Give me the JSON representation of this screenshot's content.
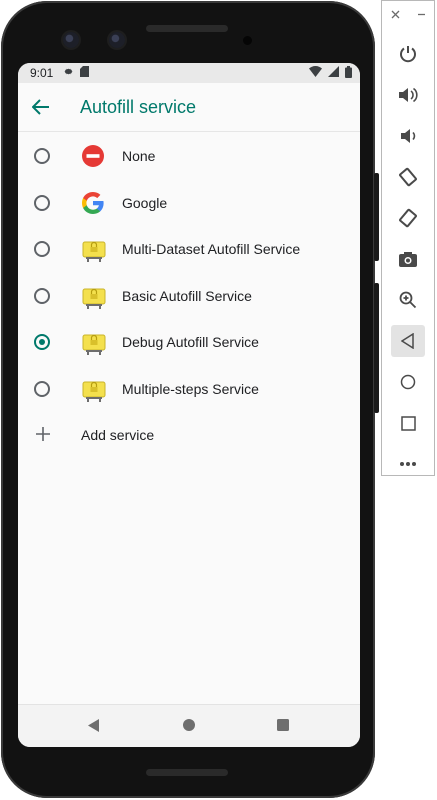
{
  "status_bar": {
    "time": "9:01"
  },
  "app_bar": {
    "title": "Autofill service"
  },
  "services": [
    {
      "label": "None",
      "icon": "none-circle-icon",
      "selected": false
    },
    {
      "label": "Google",
      "icon": "google-g-icon",
      "selected": false
    },
    {
      "label": "Multi-Dataset Autofill Service",
      "icon": "android-lock-app-icon",
      "selected": false
    },
    {
      "label": "Basic Autofill Service",
      "icon": "android-lock-app-icon",
      "selected": false
    },
    {
      "label": "Debug Autofill Service",
      "icon": "android-lock-app-icon",
      "selected": true
    },
    {
      "label": "Multiple-steps Service",
      "icon": "android-lock-app-icon",
      "selected": false
    }
  ],
  "add_service": {
    "label": "Add service"
  },
  "emulator_panel": {
    "top_controls": [
      "close",
      "minimize"
    ],
    "tools": [
      "power",
      "volume-up",
      "volume-down",
      "rotate-left",
      "rotate-right",
      "screenshot",
      "zoom",
      "back",
      "home",
      "overview",
      "more"
    ],
    "active_tool": "back"
  },
  "colors": {
    "accent": "#00796b",
    "none_red": "#e53935",
    "lock_yellow": "#f4e04d"
  }
}
